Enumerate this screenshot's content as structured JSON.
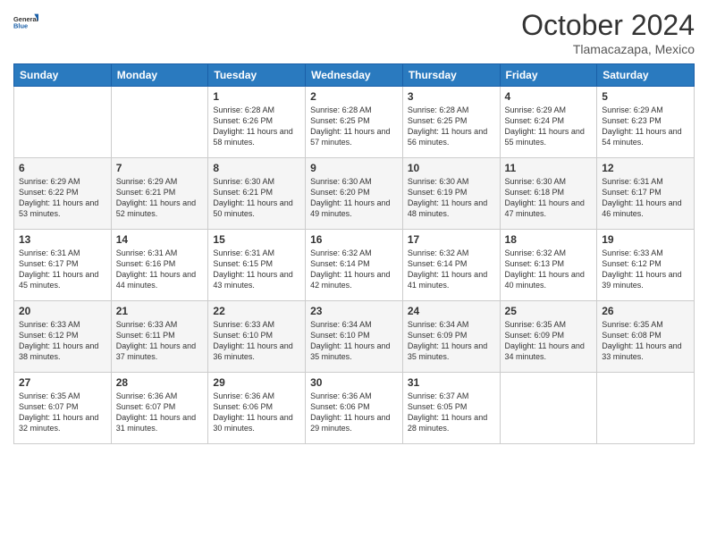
{
  "logo": {
    "line1": "General",
    "line2": "Blue"
  },
  "title": "October 2024",
  "subtitle": "Tlamacazapa, Mexico",
  "days_header": [
    "Sunday",
    "Monday",
    "Tuesday",
    "Wednesday",
    "Thursday",
    "Friday",
    "Saturday"
  ],
  "weeks": [
    [
      {
        "day": "",
        "info": ""
      },
      {
        "day": "",
        "info": ""
      },
      {
        "day": "1",
        "info": "Sunrise: 6:28 AM\nSunset: 6:26 PM\nDaylight: 11 hours\nand 58 minutes."
      },
      {
        "day": "2",
        "info": "Sunrise: 6:28 AM\nSunset: 6:25 PM\nDaylight: 11 hours\nand 57 minutes."
      },
      {
        "day": "3",
        "info": "Sunrise: 6:28 AM\nSunset: 6:25 PM\nDaylight: 11 hours\nand 56 minutes."
      },
      {
        "day": "4",
        "info": "Sunrise: 6:29 AM\nSunset: 6:24 PM\nDaylight: 11 hours\nand 55 minutes."
      },
      {
        "day": "5",
        "info": "Sunrise: 6:29 AM\nSunset: 6:23 PM\nDaylight: 11 hours\nand 54 minutes."
      }
    ],
    [
      {
        "day": "6",
        "info": "Sunrise: 6:29 AM\nSunset: 6:22 PM\nDaylight: 11 hours\nand 53 minutes."
      },
      {
        "day": "7",
        "info": "Sunrise: 6:29 AM\nSunset: 6:21 PM\nDaylight: 11 hours\nand 52 minutes."
      },
      {
        "day": "8",
        "info": "Sunrise: 6:30 AM\nSunset: 6:21 PM\nDaylight: 11 hours\nand 50 minutes."
      },
      {
        "day": "9",
        "info": "Sunrise: 6:30 AM\nSunset: 6:20 PM\nDaylight: 11 hours\nand 49 minutes."
      },
      {
        "day": "10",
        "info": "Sunrise: 6:30 AM\nSunset: 6:19 PM\nDaylight: 11 hours\nand 48 minutes."
      },
      {
        "day": "11",
        "info": "Sunrise: 6:30 AM\nSunset: 6:18 PM\nDaylight: 11 hours\nand 47 minutes."
      },
      {
        "day": "12",
        "info": "Sunrise: 6:31 AM\nSunset: 6:17 PM\nDaylight: 11 hours\nand 46 minutes."
      }
    ],
    [
      {
        "day": "13",
        "info": "Sunrise: 6:31 AM\nSunset: 6:17 PM\nDaylight: 11 hours\nand 45 minutes."
      },
      {
        "day": "14",
        "info": "Sunrise: 6:31 AM\nSunset: 6:16 PM\nDaylight: 11 hours\nand 44 minutes."
      },
      {
        "day": "15",
        "info": "Sunrise: 6:31 AM\nSunset: 6:15 PM\nDaylight: 11 hours\nand 43 minutes."
      },
      {
        "day": "16",
        "info": "Sunrise: 6:32 AM\nSunset: 6:14 PM\nDaylight: 11 hours\nand 42 minutes."
      },
      {
        "day": "17",
        "info": "Sunrise: 6:32 AM\nSunset: 6:14 PM\nDaylight: 11 hours\nand 41 minutes."
      },
      {
        "day": "18",
        "info": "Sunrise: 6:32 AM\nSunset: 6:13 PM\nDaylight: 11 hours\nand 40 minutes."
      },
      {
        "day": "19",
        "info": "Sunrise: 6:33 AM\nSunset: 6:12 PM\nDaylight: 11 hours\nand 39 minutes."
      }
    ],
    [
      {
        "day": "20",
        "info": "Sunrise: 6:33 AM\nSunset: 6:12 PM\nDaylight: 11 hours\nand 38 minutes."
      },
      {
        "day": "21",
        "info": "Sunrise: 6:33 AM\nSunset: 6:11 PM\nDaylight: 11 hours\nand 37 minutes."
      },
      {
        "day": "22",
        "info": "Sunrise: 6:33 AM\nSunset: 6:10 PM\nDaylight: 11 hours\nand 36 minutes."
      },
      {
        "day": "23",
        "info": "Sunrise: 6:34 AM\nSunset: 6:10 PM\nDaylight: 11 hours\nand 35 minutes."
      },
      {
        "day": "24",
        "info": "Sunrise: 6:34 AM\nSunset: 6:09 PM\nDaylight: 11 hours\nand 35 minutes."
      },
      {
        "day": "25",
        "info": "Sunrise: 6:35 AM\nSunset: 6:09 PM\nDaylight: 11 hours\nand 34 minutes."
      },
      {
        "day": "26",
        "info": "Sunrise: 6:35 AM\nSunset: 6:08 PM\nDaylight: 11 hours\nand 33 minutes."
      }
    ],
    [
      {
        "day": "27",
        "info": "Sunrise: 6:35 AM\nSunset: 6:07 PM\nDaylight: 11 hours\nand 32 minutes."
      },
      {
        "day": "28",
        "info": "Sunrise: 6:36 AM\nSunset: 6:07 PM\nDaylight: 11 hours\nand 31 minutes."
      },
      {
        "day": "29",
        "info": "Sunrise: 6:36 AM\nSunset: 6:06 PM\nDaylight: 11 hours\nand 30 minutes."
      },
      {
        "day": "30",
        "info": "Sunrise: 6:36 AM\nSunset: 6:06 PM\nDaylight: 11 hours\nand 29 minutes."
      },
      {
        "day": "31",
        "info": "Sunrise: 6:37 AM\nSunset: 6:05 PM\nDaylight: 11 hours\nand 28 minutes."
      },
      {
        "day": "",
        "info": ""
      },
      {
        "day": "",
        "info": ""
      }
    ]
  ]
}
